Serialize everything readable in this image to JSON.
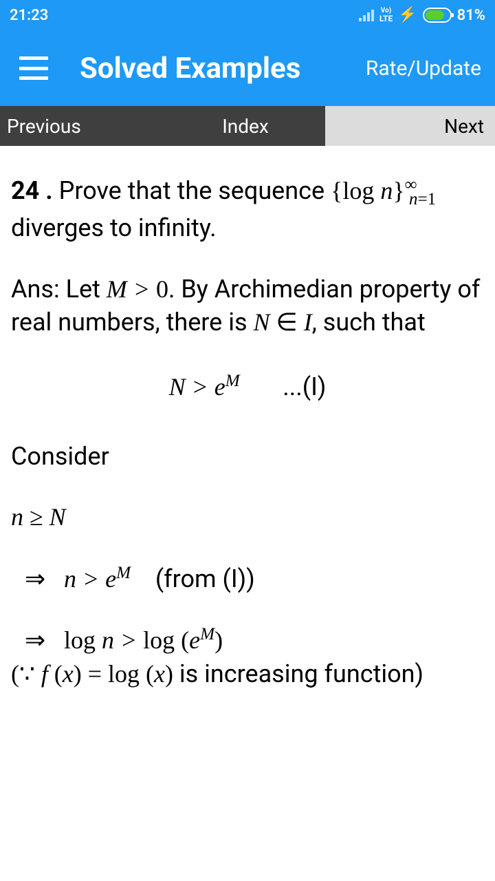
{
  "statusbar": {
    "time": "21:23",
    "network_type_top": "Vo)",
    "network_type_bottom": "LTE",
    "battery_pct": "81%"
  },
  "appbar": {
    "title": "Solved Examples",
    "rate_label": "Rate/Update"
  },
  "tabs": {
    "prev": "Previous",
    "index": "Index",
    "next": "Next"
  },
  "content": {
    "qnum": "24 .",
    "q_part1": " Prove that the sequence ",
    "q_part2": " diverges to infinity.",
    "ans_part1": "Ans: Let ",
    "ans_part2": ". By Archimedian property of real numbers, there is ",
    "ans_part3": ", such that",
    "eq1_label": "...(I)",
    "consider": "Consider",
    "from_label": "(from (I))",
    "incr_part1": " is increasing function)"
  }
}
